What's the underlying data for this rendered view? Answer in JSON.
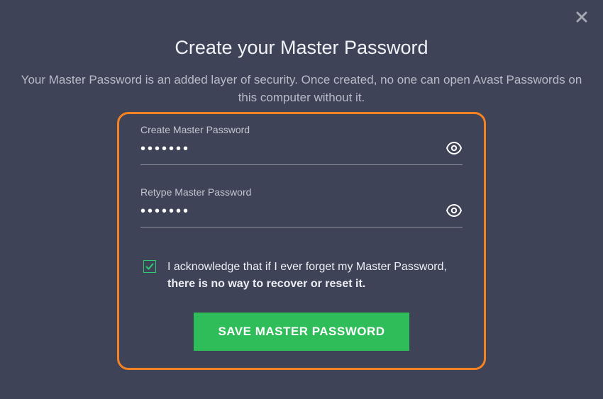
{
  "header": {
    "title": "Create your Master Password",
    "subtitle": "Your Master Password is an added layer of security. Once created, no one can open Avast Passwords on this computer without it."
  },
  "fields": {
    "create": {
      "label": "Create Master Password",
      "value": "•••••••"
    },
    "retype": {
      "label": "Retype Master Password",
      "value": "•••••••"
    }
  },
  "acknowledge": {
    "checked": true,
    "text_prefix": "I acknowledge that if I ever forget my Master Password, ",
    "text_bold": "there is no way to recover or reset it."
  },
  "actions": {
    "save_label": "Save Master Password"
  },
  "colors": {
    "accent_border": "#f58220",
    "primary_green": "#2ebd59",
    "checkbox_green": "#2ecc71",
    "background": "#3e4358"
  }
}
